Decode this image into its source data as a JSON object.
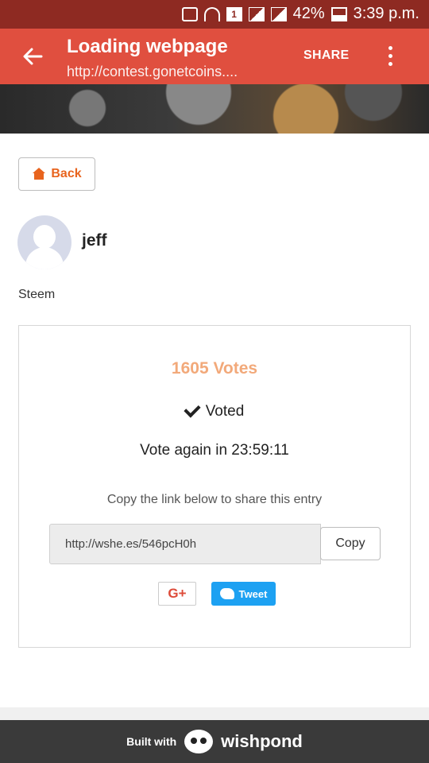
{
  "status_bar": {
    "battery": "42%",
    "time": "3:39 p.m."
  },
  "appbar": {
    "title": "Loading webpage",
    "url": "http://contest.gonetcoins....",
    "share_label": "SHARE"
  },
  "page": {
    "back_label": "Back",
    "username": "jeff",
    "description": "Steem",
    "votes": "1605 Votes",
    "voted_label": "Voted",
    "vote_again": "Vote again in 23:59:11",
    "copy_hint": "Copy the link below to share this entry",
    "share_link": "http://wshe.es/546pcH0h",
    "copy_label": "Copy",
    "gplus_label": "G+",
    "tweet_label": "Tweet"
  },
  "footer": {
    "built_with": "Built with",
    "brand": "wishpond"
  },
  "colors": {
    "appbar": "#e04f3f",
    "statusbar": "#8e2a22",
    "accent": "#e8641e",
    "votes": "#f2a97a",
    "tweet": "#1da1f2"
  }
}
